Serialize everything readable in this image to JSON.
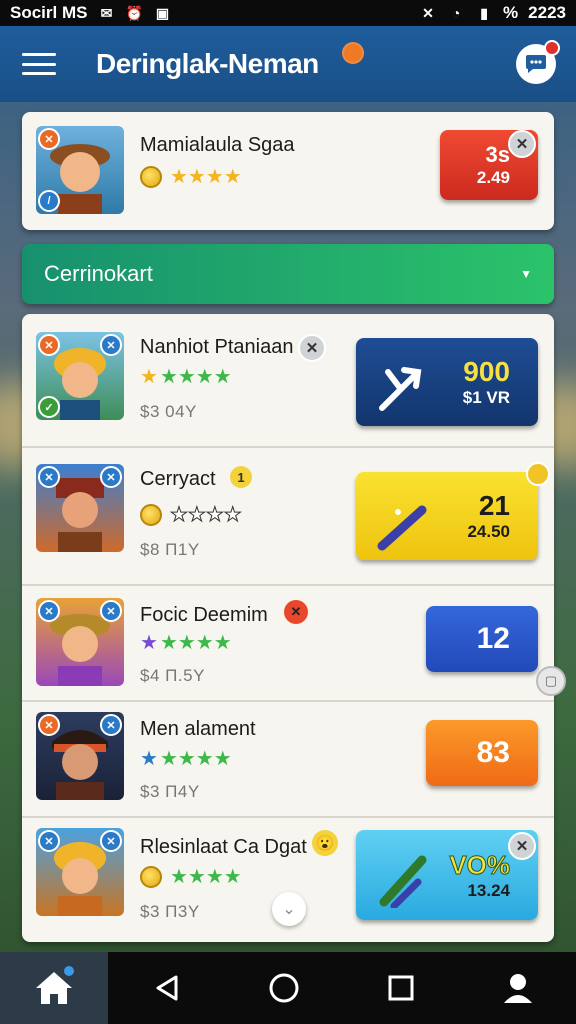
{
  "status_bar": {
    "left_text": "Socirl MS",
    "time": "2223",
    "battery": "%"
  },
  "header": {
    "title": "Deringlak-Neman",
    "menu_icon": "hamburger-icon",
    "chat_icon": "chat-bubble-icon"
  },
  "featured": {
    "name": "Mamialaula Sgaa",
    "rating": 4,
    "price_label": "3s",
    "price_value": "2.49",
    "tile_color": "#e0362a"
  },
  "section": {
    "label": "Cerrinokart",
    "chevron": "chevron-down-icon"
  },
  "items": [
    {
      "name": "Nanhiot Ptaniaan",
      "rating": 4,
      "sub": "$3 04Y",
      "tile_top": "900",
      "tile_bottom": "$1 VR",
      "tile_color": "#153e7c",
      "name_badge": "✕"
    },
    {
      "name": "Cerryact",
      "rating": 0,
      "sub": "$8 Π1Y",
      "tile_top": "21",
      "tile_bottom": "24.50",
      "tile_color": "#f2d615",
      "name_badge": "1"
    },
    {
      "name": "Focic Deemim",
      "rating": 4,
      "sub": "$4 Π.5Y",
      "tile_top": "12",
      "tile_bottom": "",
      "tile_color": "#2e5bd2",
      "name_badge": "✕"
    },
    {
      "name": "Men alament",
      "rating": 4,
      "sub": "$3 Π4Y",
      "tile_top": "83",
      "tile_bottom": "",
      "tile_color": "#f77f1c",
      "name_badge": ""
    },
    {
      "name": "Rlesinlaat Ca Dgat",
      "rating": 4,
      "sub": "$3 Π3Y",
      "tile_top": "VO%",
      "tile_bottom": "13.24",
      "tile_color": "#37bde8",
      "name_badge": "😮"
    }
  ],
  "nav": {
    "home": "home-icon",
    "back": "back-icon",
    "circle": "home-circle-icon",
    "square": "recents-icon",
    "profile": "profile-icon"
  }
}
